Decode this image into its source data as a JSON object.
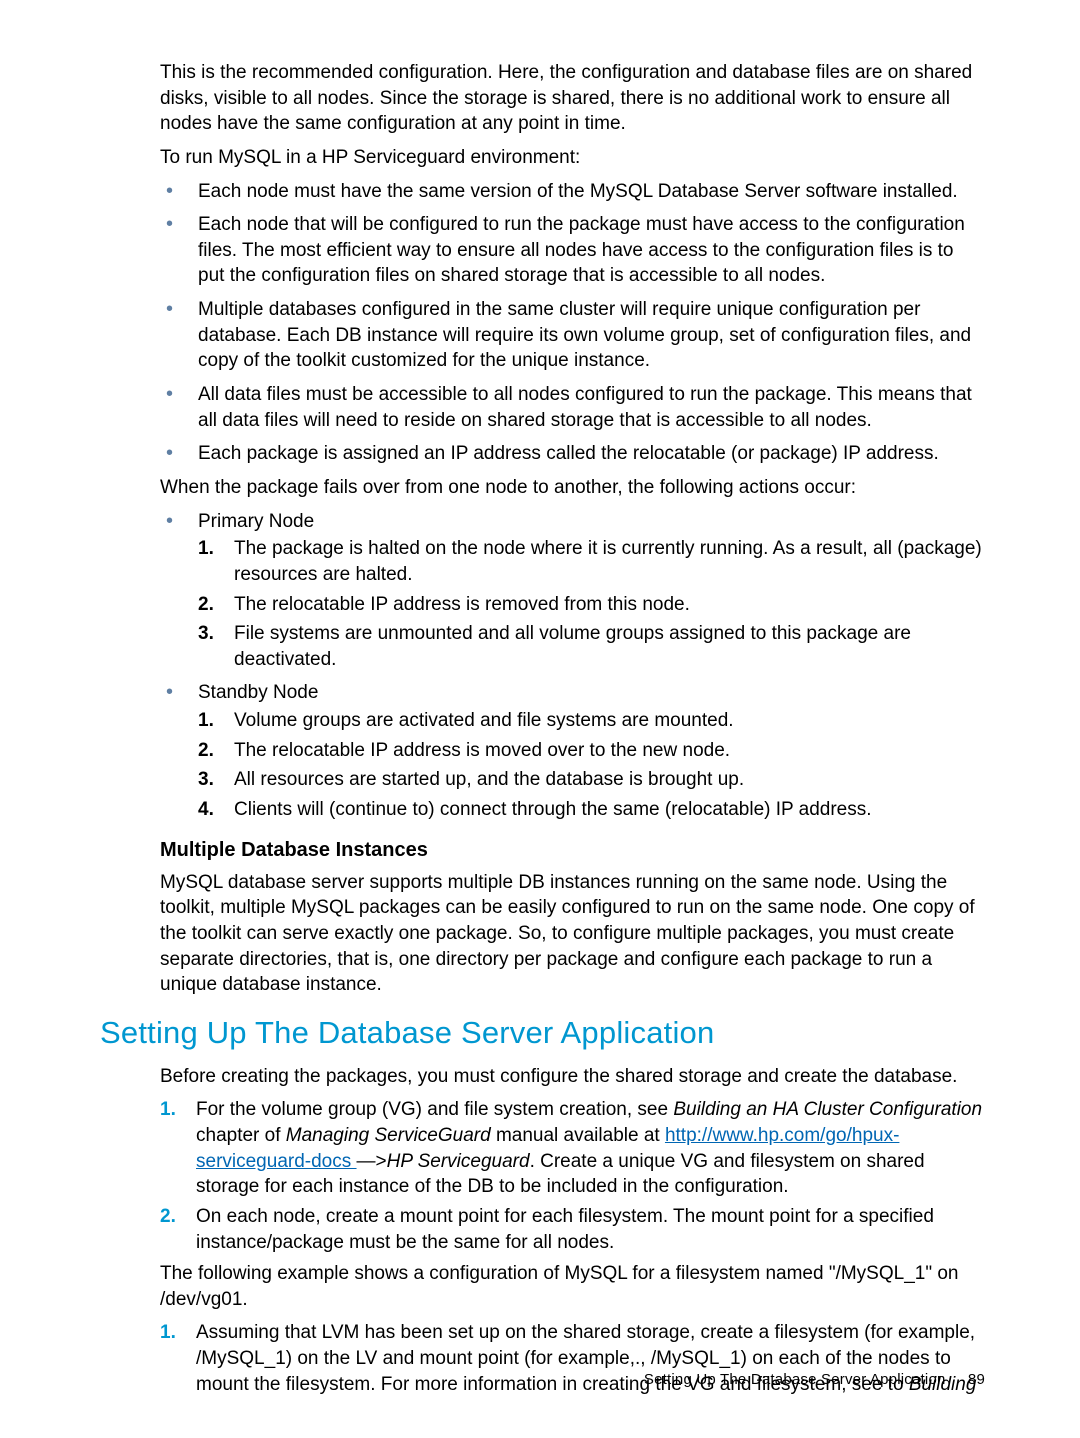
{
  "intro": {
    "p1": "This is the recommended configuration. Here, the configuration and database files are on shared disks, visible to all nodes. Since the storage is shared, there is no additional work to ensure all nodes have the same configuration at any point in time.",
    "p2": "To run MySQL in a HP Serviceguard environment:"
  },
  "env_bullets": [
    "Each node must have the same version of the MySQL Database Server software installed.",
    "Each node that will be configured to run the package must have access to the configuration files. The most efficient way to ensure all nodes have access to the configuration files is to put the configuration files on shared storage that is accessible to all nodes.",
    "Multiple databases configured in the same cluster will require unique configuration per database. Each DB instance will require its own volume group, set of configuration files, and copy of the toolkit customized for the unique instance.",
    "All data files must be accessible to all nodes configured to run the package. This means that all data files will need to reside on shared storage that is accessible to all nodes.",
    "Each package is assigned an IP address called the relocatable (or package) IP address."
  ],
  "failover_intro": "When the package fails over from one node to another, the following actions occur:",
  "primary": {
    "title": "Primary Node",
    "steps": [
      "The package is halted on the node where it is currently running. As a result, all (package) resources are halted.",
      "The relocatable IP address is removed from this node.",
      "File systems are unmounted and all volume groups assigned to this package are deactivated."
    ]
  },
  "standby": {
    "title": "Standby Node",
    "steps": [
      "Volume groups are activated and file systems are mounted.",
      "The relocatable IP address is moved over to the new node.",
      "All resources are started up, and the database is brought up.",
      "Clients will (continue to) connect through the same (relocatable) IP address."
    ]
  },
  "mdbi": {
    "heading": "Multiple Database Instances",
    "body": "MySQL database server supports multiple DB instances running on the same node. Using the toolkit, multiple MySQL packages can be easily configured to run on the same node. One copy of the toolkit can serve exactly one package. So, to configure multiple packages, you must create separate directories, that is, one directory per package and configure each package to run a unique database instance."
  },
  "section_heading": "Setting Up The Database Server Application",
  "setup": {
    "intro": "Before creating the packages, you must configure the shared storage and create the database.",
    "step1_prefix": "For the volume group (VG) and file system creation, see ",
    "step1_em1": "Building an HA Cluster Configuration",
    "step1_mid1": " chapter of ",
    "step1_em2": "Managing ServiceGuard",
    "step1_mid2": " manual available at ",
    "step1_link": "http://www.hp.com/go/hpux-serviceguard-docs ",
    "step1_mid3": " —>",
    "step1_em3": "HP Serviceguard",
    "step1_tail": ". Create a unique VG and filesystem on shared storage for each instance of the DB to be included in the configuration.",
    "step2": "On each node, create a mount point for each filesystem. The mount point for a specified instance/package must be the same for all nodes.",
    "example_intro": "The following example shows a configuration of MySQL for a filesystem named \"/MySQL_1\" on /dev/vg01.",
    "ex_step1_prefix": "Assuming that LVM has been set up on the shared storage, create a filesystem (for example, /MySQL_1) on the LV and mount point (for example,., /MySQL_1) on each of the nodes to mount the filesystem. For more information in creating the VG and filesystem, see to ",
    "ex_step1_em": "Building"
  },
  "footer": {
    "label": "Setting Up The Database Server Application",
    "page": "89"
  }
}
